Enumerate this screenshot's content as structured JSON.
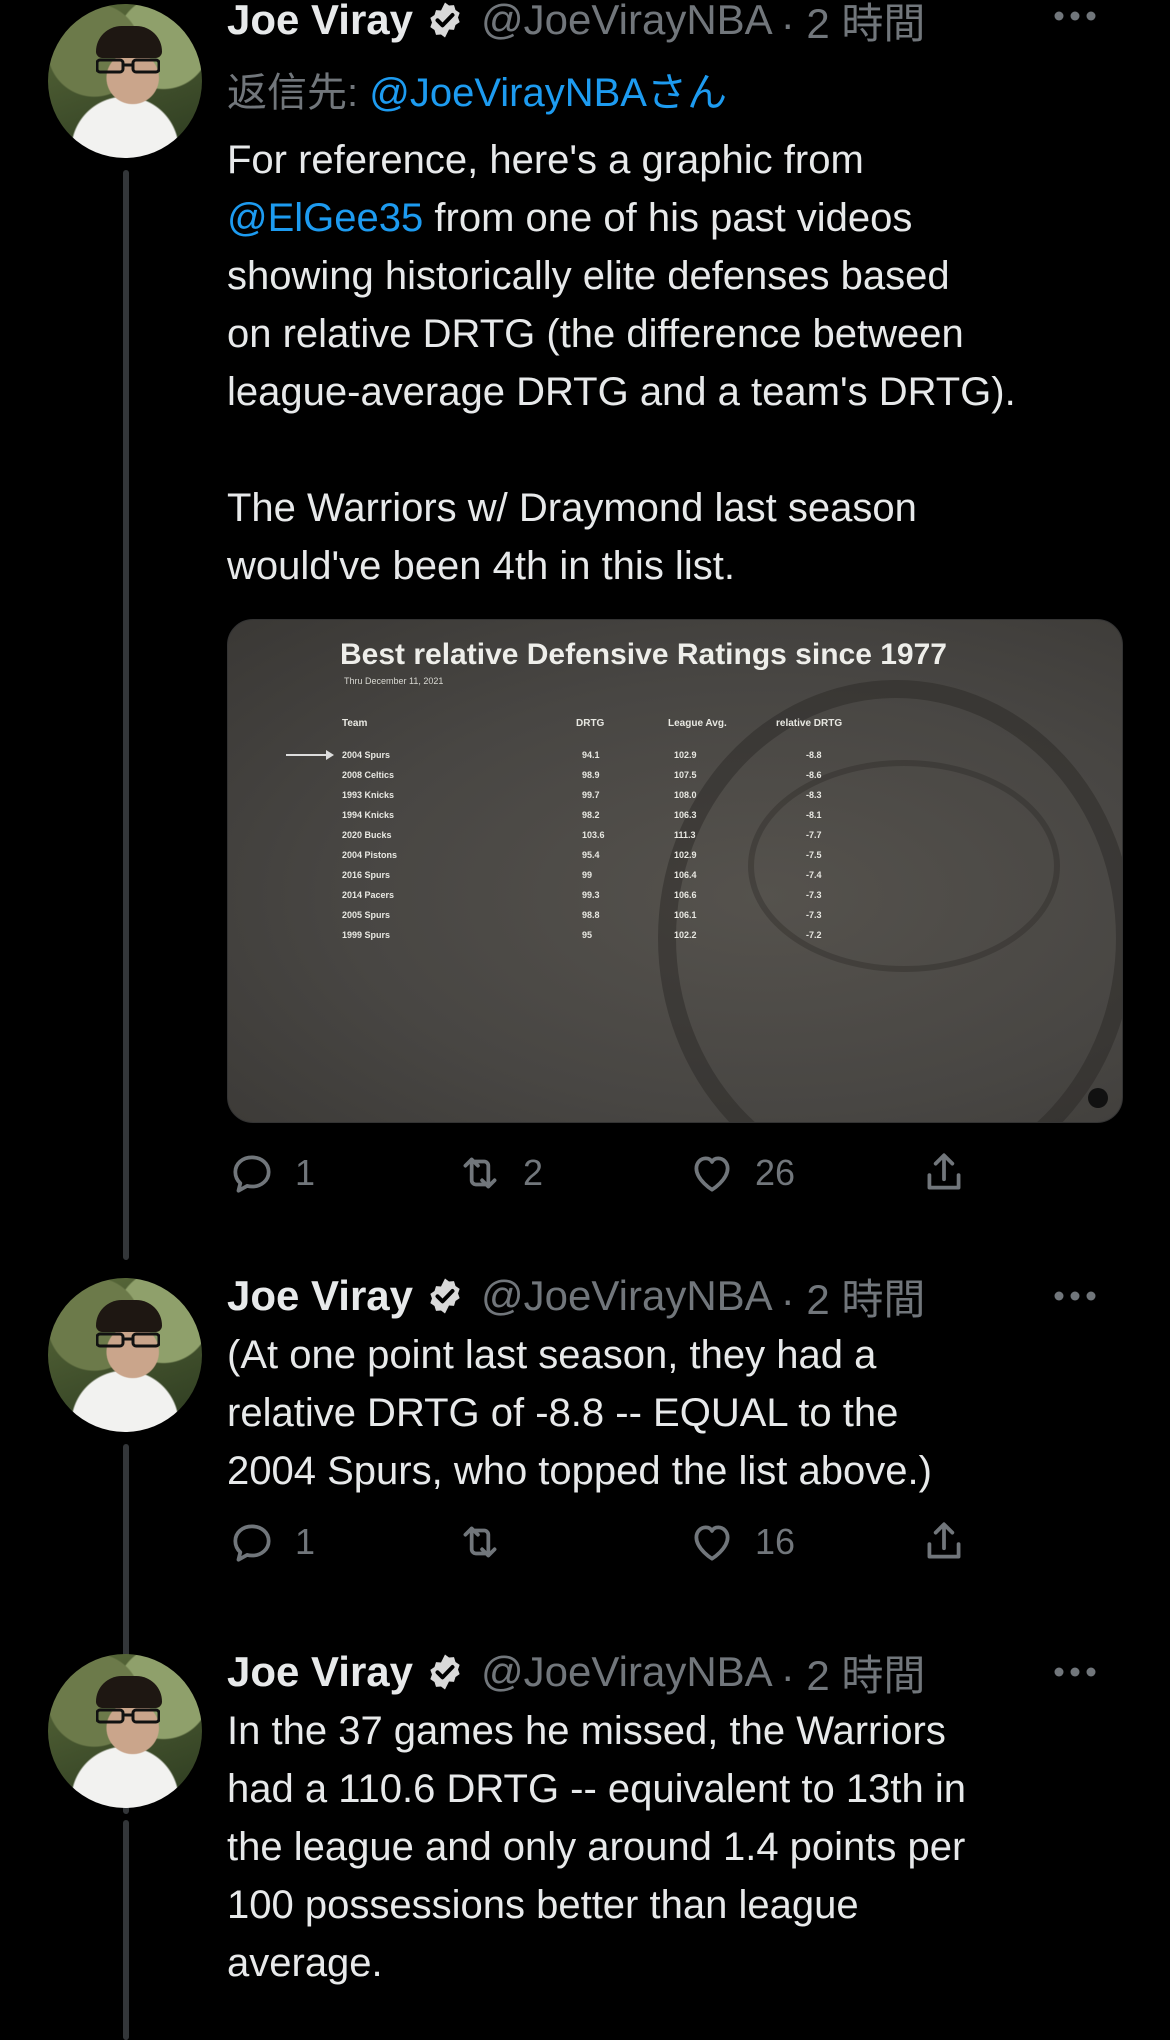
{
  "tweets": [
    {
      "name": "Joe Viray",
      "handle": "@JoeVirayNBA",
      "time": "· 2 時間",
      "reply_prefix": "返信先: ",
      "reply_mention": "@JoeVirayNBAさん",
      "text_part1": "For reference, here's a graphic from",
      "text_mention": "@ElGee35",
      "text_part2": " from one of his past videos\nshowing historically elite defenses based\non relative DRTG (the difference between\nleague-average DRTG and a team's DRTG).\n\nThe Warriors w/ Draymond last season\nwould've been 4th in this list.",
      "replies": "1",
      "retweets": "2",
      "likes": "26"
    },
    {
      "name": "Joe Viray",
      "handle": "@JoeVirayNBA",
      "time": "· 2 時間",
      "text": "(At one point last season, they had a\nrelative DRTG of -8.8 -- EQUAL to the\n2004 Spurs, who topped the list above.)",
      "replies": "1",
      "retweets": "",
      "likes": "16"
    },
    {
      "name": "Joe Viray",
      "handle": "@JoeVirayNBA",
      "time": "· 2 時間",
      "text": "In the 37 games he missed, the Warriors\nhad a 110.6 DRTG -- equivalent to 13th in\nthe league and only around 1.4 points per\n100 possessions better than league\naverage."
    }
  ],
  "media": {
    "title": "Best relative Defensive Ratings since 1977",
    "subtitle": "Thru December 11, 2021",
    "headers": [
      "Team",
      "DRTG",
      "League Avg.",
      "relative DRTG"
    ],
    "rows": [
      [
        "2004 Spurs",
        "94.1",
        "102.9",
        "-8.8"
      ],
      [
        "2008 Celtics",
        "98.9",
        "107.5",
        "-8.6"
      ],
      [
        "1993 Knicks",
        "99.7",
        "108.0",
        "-8.3"
      ],
      [
        "1994 Knicks",
        "98.2",
        "106.3",
        "-8.1"
      ],
      [
        "2020 Bucks",
        "103.6",
        "111.3",
        "-7.7"
      ],
      [
        "2004 Pistons",
        "95.4",
        "102.9",
        "-7.5"
      ],
      [
        "2016 Spurs",
        "99",
        "106.4",
        "-7.4"
      ],
      [
        "2014 Pacers",
        "99.3",
        "106.6",
        "-7.3"
      ],
      [
        "2005 Spurs",
        "98.8",
        "106.1",
        "-7.3"
      ],
      [
        "1999 Spurs",
        "95",
        "102.2",
        "-7.2"
      ]
    ]
  },
  "icons": {
    "verified": "verified-badge-icon",
    "more": "more-dots-icon",
    "reply": "reply-bubble-icon",
    "retweet": "retweet-icon",
    "like": "heart-icon",
    "share": "share-icon"
  },
  "colors": {
    "background": "#000000",
    "text": "#e7e9ea",
    "muted": "#71767b",
    "link": "#1d9bf0"
  }
}
